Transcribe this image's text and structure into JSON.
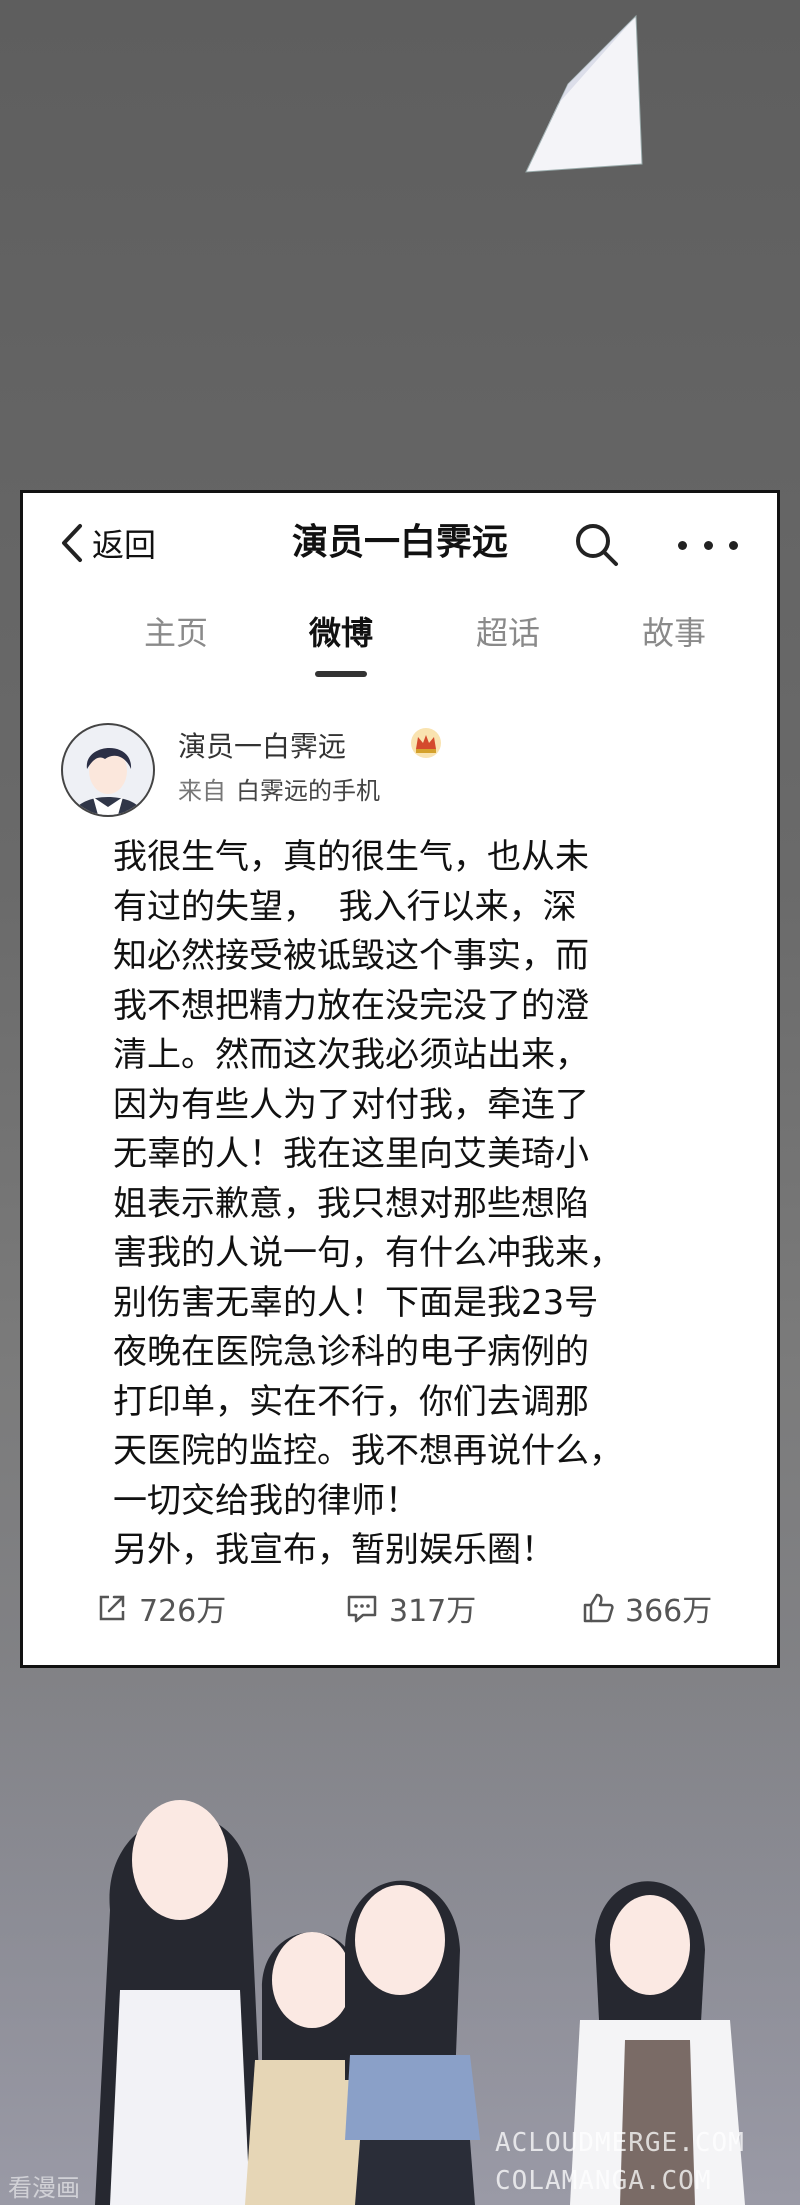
{
  "nav": {
    "back_label": "返回",
    "title": "演员一白霁远"
  },
  "tabs": [
    "主页",
    "微博",
    "超话",
    "故事"
  ],
  "profile": {
    "name": "演员一白霁远",
    "source_prefix": "来自",
    "source_device": "白霁远的手机"
  },
  "post_lines": [
    "我很生气，真的很生气，也从未",
    "有过的失望，  我入行以来，深",
    "知必然接受被诋毁这个事实，而",
    "我不想把精力放在没完没了的澄",
    "清上。然而这次我必须站出来，",
    "因为有些人为了对付我，牵连了",
    "无辜的人！我在这里向艾美琦小",
    "姐表示歉意，我只想对那些想陷",
    "害我的人说一句，有什么冲我来，",
    "别伤害无辜的人！下面是我23号",
    "夜晚在医院急诊科的电子病例的",
    "打印单，实在不行，你们去调那",
    "天医院的监控。我不想再说什么，",
    "一切交给我的律师！",
    "另外，我宣布，暂别娱乐圈！"
  ],
  "actions": {
    "share": "726万",
    "comment": "317万",
    "like": "366万"
  },
  "watermarks": {
    "line1": "ACLOUDMERGE.COM",
    "line2": "COLAMANGA.COM",
    "left": "看漫画"
  }
}
